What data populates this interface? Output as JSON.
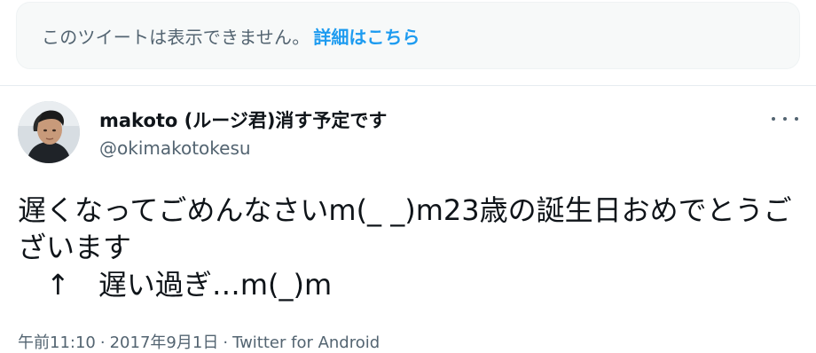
{
  "notice": {
    "text": "このツイートは表示できません。",
    "link": "詳細はこちら"
  },
  "tweet": {
    "display_name": "makoto (ルージ君)消す予定です",
    "handle": "@okimakotokesu",
    "body": "遅くなってごめんなさいm(_ _)m23歳の誕生日おめでとうございます\n　↑　遅い過ぎ…m(_)m",
    "time": "午前11:10",
    "separator": "·",
    "date": "2017年9月1日",
    "source": "Twitter for Android"
  },
  "icons": {
    "avatar": "avatar",
    "more": "more-icon"
  },
  "colors": {
    "link": "#1d9bf0",
    "secondary_text": "#536471",
    "notice_bg": "#f7f9f9"
  }
}
